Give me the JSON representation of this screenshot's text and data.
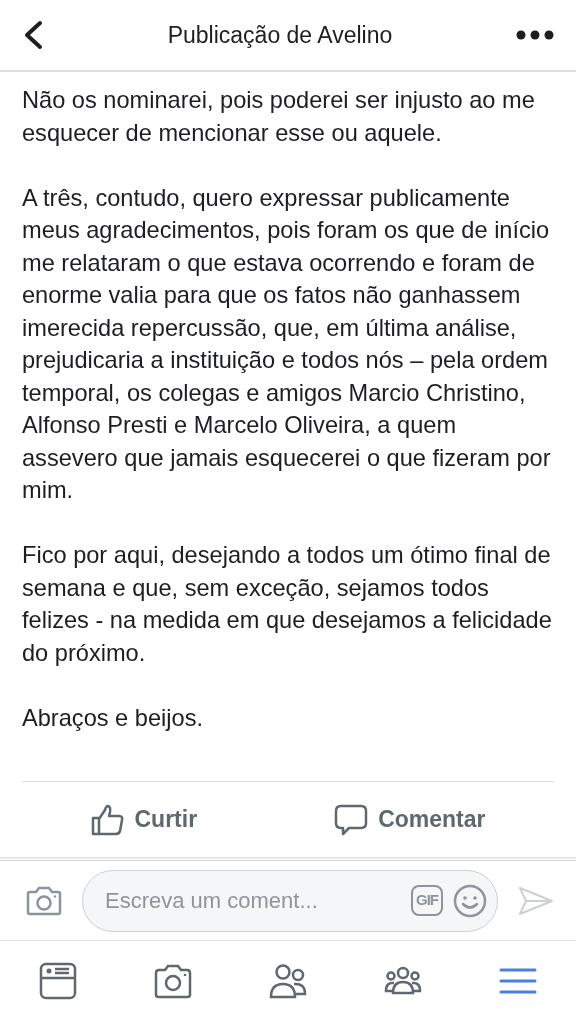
{
  "header": {
    "title": "Publicação de Avelino"
  },
  "post": {
    "paragraphs": [
      "Não os nominarei, pois poderei ser injusto ao me esquecer de mencionar esse ou aquele.",
      "A três, contudo, quero expressar publicamente meus agradecimentos, pois foram os que de início me relataram o que estava ocorrendo e foram de enorme valia para que os fatos não ganhassem imerecida repercussão, que, em última análise, prejudicaria a instituição e todos nós – pela ordem temporal, os colegas e amigos Marcio Christino, Alfonso Presti e Marcelo Oliveira, a quem assevero que jamais esquecerei o que fizeram por mim.",
      "Fico por aqui, desejando a todos um ótimo final de semana e que, sem exceção, sejamos todos felizes - na medida em que desejamos a felicidade do próximo.",
      "Abraços e beijos."
    ]
  },
  "actions": [
    {
      "kind": "like",
      "label": "Curtir"
    },
    {
      "kind": "comment",
      "label": "Comentar"
    }
  ],
  "comment_bar": {
    "placeholder": "Escreva um coment...",
    "gif": "GIF"
  },
  "tabs": [
    {
      "kind": "feed",
      "selected": false
    },
    {
      "kind": "camera",
      "selected": false
    },
    {
      "kind": "friends",
      "selected": false
    },
    {
      "kind": "groups",
      "selected": false
    },
    {
      "kind": "menu",
      "selected": true
    }
  ]
}
